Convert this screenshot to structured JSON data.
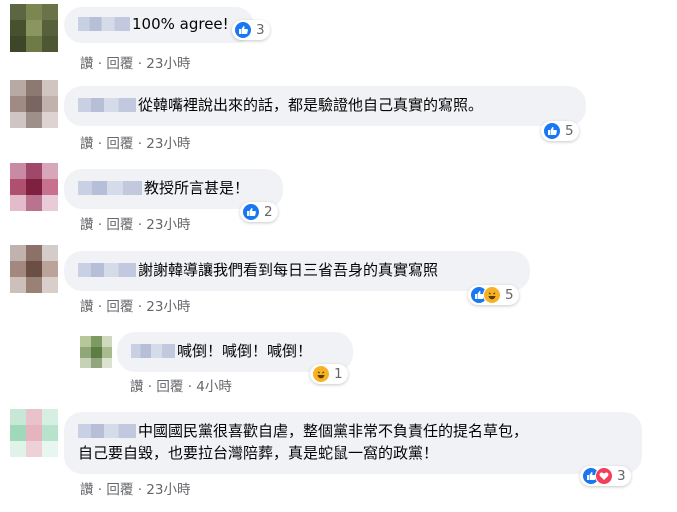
{
  "comments": [
    {
      "name_blur": "",
      "text": "100% agree!",
      "actions": {
        "like": "讚",
        "reply": "回覆",
        "sep": "·",
        "time": "23小時"
      },
      "reaction_count": "3",
      "reactions": [
        "like-icon"
      ]
    },
    {
      "text": "從韓嘴裡說出來的話，都是驗證他自己真實的寫照。",
      "actions": {
        "like": "讚",
        "reply": "回覆",
        "sep": "·",
        "time": "23小時"
      },
      "reaction_count": "5",
      "reactions": [
        "like-icon"
      ]
    },
    {
      "text": "教授所言甚是！",
      "actions": {
        "like": "讚",
        "reply": "回覆",
        "sep": "·",
        "time": "23小時"
      },
      "reaction_count": "2",
      "reactions": [
        "like-icon"
      ]
    },
    {
      "text": "謝謝韓導讓我們看到每日三省吾身的真實寫照",
      "actions": {
        "like": "讚",
        "reply": "回覆",
        "sep": "·",
        "time": "23小時"
      },
      "reaction_count": "5",
      "reactions": [
        "like-icon",
        "haha-icon"
      ]
    },
    {
      "text": "喊倒！喊倒！喊倒！",
      "actions": {
        "like": "讚",
        "reply": "回覆",
        "sep": "·",
        "time": "4小時"
      },
      "reaction_count": "1",
      "reactions": [
        "haha-icon"
      ]
    },
    {
      "text_line1": "中國國民黨很喜歡自虐，整個黨非常不負責任的提名草包，",
      "text_line2": "自己要自毀，也要拉台灣陪葬，真是蛇鼠一窩的政黨！",
      "actions": {
        "like": "讚",
        "reply": "回覆",
        "sep": "·",
        "time": "23小時"
      },
      "reaction_count": "3",
      "reactions": [
        "like-icon",
        "love-icon"
      ]
    }
  ],
  "colors": {
    "bubble_bg": "#f0f2f5",
    "meta_text": "#65676b",
    "like_blue": "#1877f2",
    "haha_yellow": "#f7b125",
    "love_red": "#f33e58"
  }
}
